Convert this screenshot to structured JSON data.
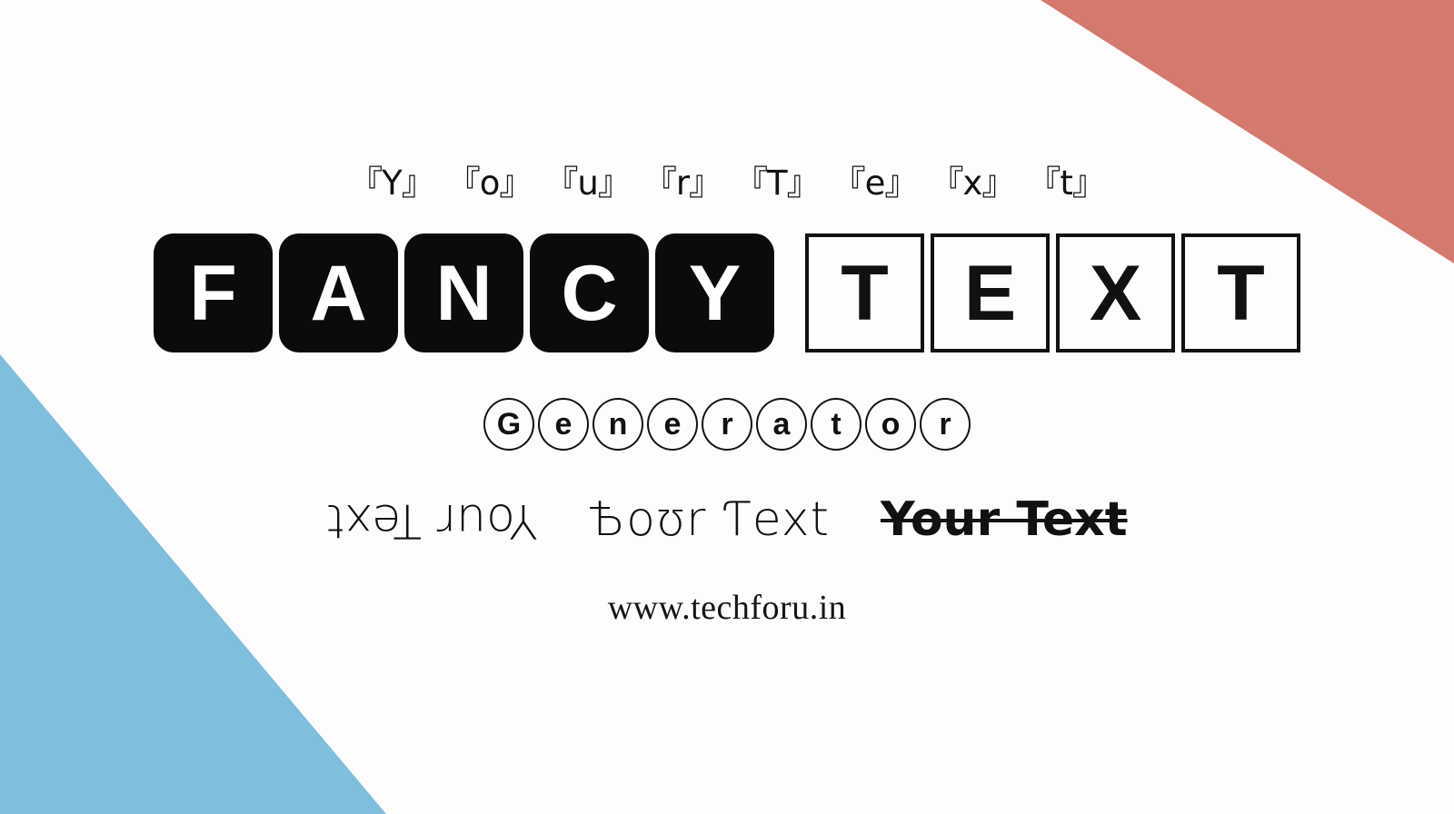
{
  "background": {
    "color": "#fdfdfd",
    "corner_top_right_color": "#d4796e",
    "corner_bottom_left_color": "#7fbedc"
  },
  "bracket_row": {
    "source_text": "Your Text",
    "letters": [
      "『Y』",
      "『o』",
      "『u』",
      "『r』",
      "『T』",
      "『e』",
      "『x』",
      "『t』"
    ]
  },
  "title": {
    "word_one": "FANCY",
    "word_two": "TEXT",
    "filled_letters": [
      "F",
      "A",
      "N",
      "C",
      "Y"
    ],
    "outlined_letters": [
      "T",
      "E",
      "X",
      "T"
    ],
    "filled_tile_color": "#0b0b0b",
    "filled_letter_color": "#ffffff",
    "outlined_border_color": "#111111",
    "outlined_letter_color": "#111111"
  },
  "subtitle": {
    "word": "Generator",
    "letters": [
      "G",
      "e",
      "n",
      "e",
      "r",
      "a",
      "t",
      "o",
      "r"
    ]
  },
  "variants": [
    {
      "name": "upside-down",
      "text": "Your Text"
    },
    {
      "name": "stylized-unicode",
      "text": "Ѣoʊr Ƭext"
    },
    {
      "name": "strikethrough",
      "text": "Your Text"
    }
  ],
  "footer": {
    "url": "www.techforu.in"
  }
}
